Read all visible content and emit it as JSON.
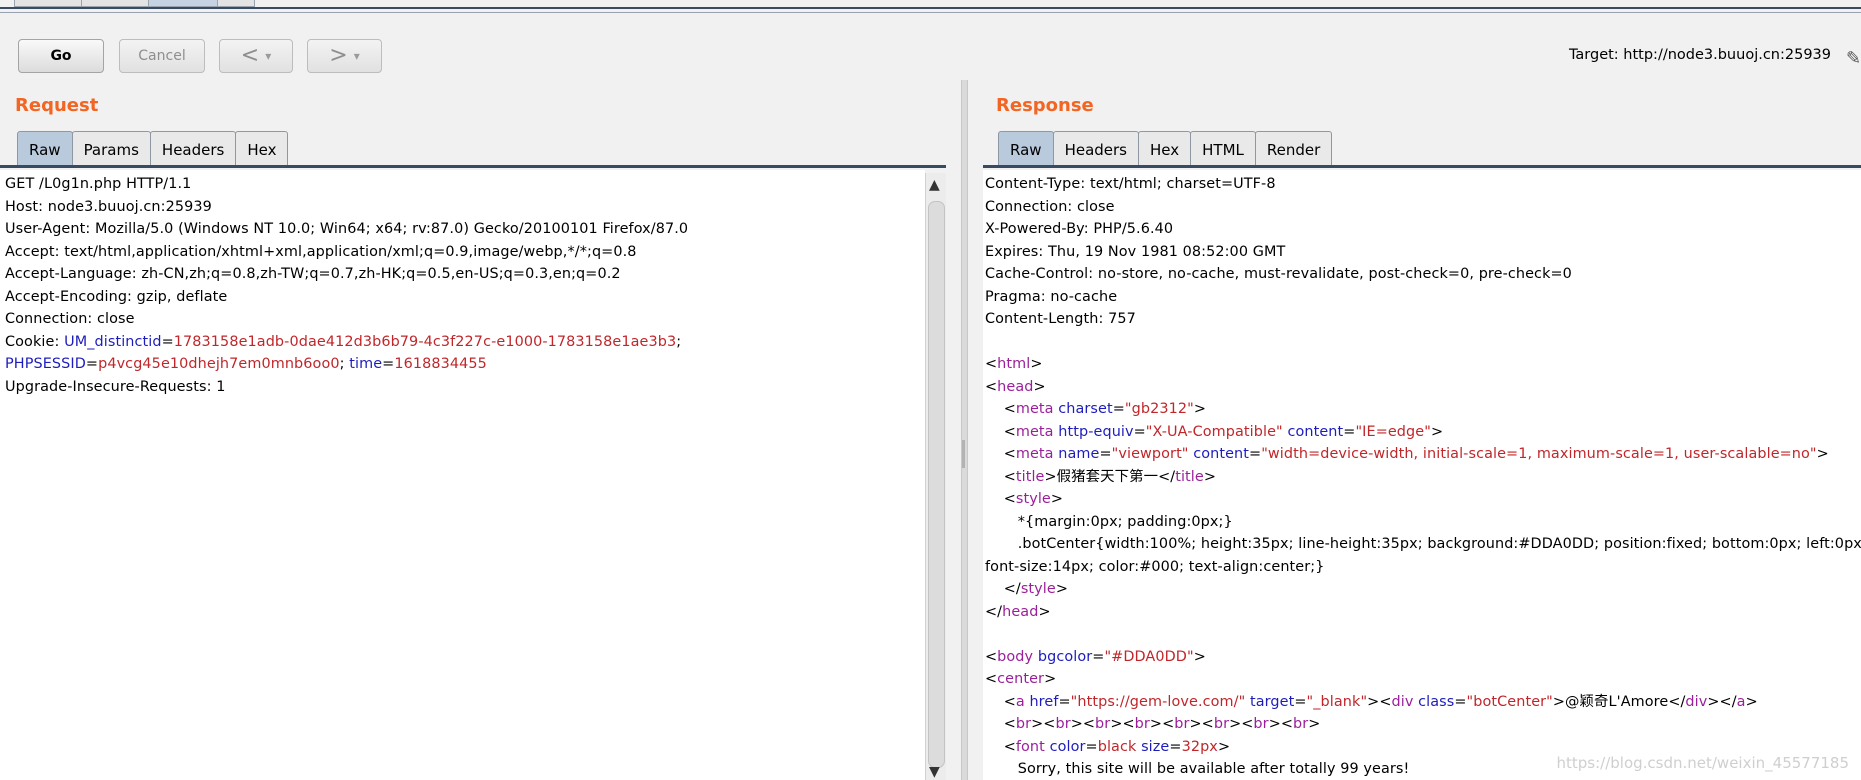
{
  "toolbar": {
    "go_label": "Go",
    "cancel_label": "Cancel",
    "back_glyph": "<",
    "forward_glyph": ">",
    "dropdown_glyph": "▾",
    "target_label": "Target: http://node3.buuoj.cn:25939",
    "edit_icon": "pencil-icon"
  },
  "request": {
    "title": "Request",
    "tabs": [
      "Raw",
      "Params",
      "Headers",
      "Hex"
    ],
    "active_tab": "Raw",
    "lines": [
      [
        {
          "t": "GET /L0g1n.php HTTP/1.1",
          "c": "key"
        }
      ],
      [
        {
          "t": "Host: node3.buuoj.cn:25939",
          "c": "key"
        }
      ],
      [
        {
          "t": "User-Agent: Mozilla/5.0 (Windows NT 10.0; Win64; x64; rv:87.0) Gecko/20100101 Firefox/87.0",
          "c": "key"
        }
      ],
      [
        {
          "t": "Accept: text/html,application/xhtml+xml,application/xml;q=0.9,image/webp,*/*;q=0.8",
          "c": "key"
        }
      ],
      [
        {
          "t": "Accept-Language: zh-CN,zh;q=0.8,zh-TW;q=0.7,zh-HK;q=0.5,en-US;q=0.3,en;q=0.2",
          "c": "key"
        }
      ],
      [
        {
          "t": "Accept-Encoding: gzip, deflate",
          "c": "key"
        }
      ],
      [
        {
          "t": "Connection: close",
          "c": "key"
        }
      ],
      [
        {
          "t": "Cookie: ",
          "c": "key"
        },
        {
          "t": "UM_distinctid",
          "c": "blue"
        },
        {
          "t": "=",
          "c": "key"
        },
        {
          "t": "1783158e1adb-0dae412d3b6b79-4c3f227c-e1000-1783158e1ae3b3",
          "c": "red"
        },
        {
          "t": ";",
          "c": "key"
        }
      ],
      [
        {
          "t": "PHPSESSID",
          "c": "blue"
        },
        {
          "t": "=",
          "c": "key"
        },
        {
          "t": "p4vcg45e10dhejh7em0mnb6oo0",
          "c": "red"
        },
        {
          "t": "; ",
          "c": "key"
        },
        {
          "t": "time",
          "c": "blue"
        },
        {
          "t": "=",
          "c": "key"
        },
        {
          "t": "1618834455",
          "c": "red"
        }
      ],
      [
        {
          "t": "Upgrade-Insecure-Requests: 1",
          "c": "key"
        }
      ]
    ]
  },
  "response": {
    "title": "Response",
    "tabs": [
      "Raw",
      "Headers",
      "Hex",
      "HTML",
      "Render"
    ],
    "active_tab": "Raw",
    "lines": [
      [
        {
          "t": "Content-Type: text/html; charset=UTF-8",
          "c": "key"
        }
      ],
      [
        {
          "t": "Connection: close",
          "c": "key"
        }
      ],
      [
        {
          "t": "X-Powered-By: PHP/5.6.40",
          "c": "key"
        }
      ],
      [
        {
          "t": "Expires: Thu, 19 Nov 1981 08:52:00 GMT",
          "c": "key"
        }
      ],
      [
        {
          "t": "Cache-Control: no-store, no-cache, must-revalidate, post-check=0, pre-check=0",
          "c": "key"
        }
      ],
      [
        {
          "t": "Pragma: no-cache",
          "c": "key"
        }
      ],
      [
        {
          "t": "Content-Length: 757",
          "c": "key"
        }
      ],
      [
        {
          "t": "",
          "c": "key"
        }
      ],
      [
        {
          "t": "<",
          "c": "key"
        },
        {
          "t": "html",
          "c": "purple"
        },
        {
          "t": ">",
          "c": "key"
        }
      ],
      [
        {
          "t": "<",
          "c": "key"
        },
        {
          "t": "head",
          "c": "purple"
        },
        {
          "t": ">",
          "c": "key"
        }
      ],
      [
        {
          "t": "    <",
          "c": "key"
        },
        {
          "t": "meta",
          "c": "purple"
        },
        {
          "t": " charset",
          "c": "blue"
        },
        {
          "t": "=",
          "c": "key"
        },
        {
          "t": "\"gb2312\"",
          "c": "red"
        },
        {
          "t": ">",
          "c": "key"
        }
      ],
      [
        {
          "t": "    <",
          "c": "key"
        },
        {
          "t": "meta",
          "c": "purple"
        },
        {
          "t": " http-equiv",
          "c": "blue"
        },
        {
          "t": "=",
          "c": "key"
        },
        {
          "t": "\"X-UA-Compatible\"",
          "c": "red"
        },
        {
          "t": " content",
          "c": "blue"
        },
        {
          "t": "=",
          "c": "key"
        },
        {
          "t": "\"IE=edge\"",
          "c": "red"
        },
        {
          "t": ">",
          "c": "key"
        }
      ],
      [
        {
          "t": "    <",
          "c": "key"
        },
        {
          "t": "meta",
          "c": "purple"
        },
        {
          "t": " name",
          "c": "blue"
        },
        {
          "t": "=",
          "c": "key"
        },
        {
          "t": "\"viewport\"",
          "c": "red"
        },
        {
          "t": " content",
          "c": "blue"
        },
        {
          "t": "=",
          "c": "key"
        },
        {
          "t": "\"width=device-width, initial-scale=1, maximum-scale=1, user-scalable=no\"",
          "c": "red"
        },
        {
          "t": ">",
          "c": "key"
        }
      ],
      [
        {
          "t": "    <",
          "c": "key"
        },
        {
          "t": "title",
          "c": "purple"
        },
        {
          "t": ">",
          "c": "key"
        },
        {
          "t": "假猪套天下第一",
          "c": "key"
        },
        {
          "t": "</",
          "c": "key"
        },
        {
          "t": "title",
          "c": "purple"
        },
        {
          "t": ">",
          "c": "key"
        }
      ],
      [
        {
          "t": "    <",
          "c": "key"
        },
        {
          "t": "style",
          "c": "purple"
        },
        {
          "t": ">",
          "c": "key"
        }
      ],
      [
        {
          "t": "       *{margin:0px; padding:0px;}",
          "c": "key"
        }
      ],
      [
        {
          "t": "       .botCenter{width:100%; height:35px; line-height:35px; background:#DDA0DD; position:fixed; bottom:0px; left:0px;",
          "c": "key"
        }
      ],
      [
        {
          "t": "font-size:14px; color:#000; text-align:center;}",
          "c": "key"
        }
      ],
      [
        {
          "t": "    </",
          "c": "key"
        },
        {
          "t": "style",
          "c": "purple"
        },
        {
          "t": ">",
          "c": "key"
        }
      ],
      [
        {
          "t": "</",
          "c": "key"
        },
        {
          "t": "head",
          "c": "purple"
        },
        {
          "t": ">",
          "c": "key"
        }
      ],
      [
        {
          "t": "",
          "c": "key"
        }
      ],
      [
        {
          "t": "<",
          "c": "key"
        },
        {
          "t": "body",
          "c": "purple"
        },
        {
          "t": " bgcolor",
          "c": "blue"
        },
        {
          "t": "=",
          "c": "key"
        },
        {
          "t": "\"#DDA0DD\"",
          "c": "red"
        },
        {
          "t": ">",
          "c": "key"
        }
      ],
      [
        {
          "t": "<",
          "c": "key"
        },
        {
          "t": "center",
          "c": "purple"
        },
        {
          "t": ">",
          "c": "key"
        }
      ],
      [
        {
          "t": "    <",
          "c": "key"
        },
        {
          "t": "a",
          "c": "purple"
        },
        {
          "t": " href",
          "c": "blue"
        },
        {
          "t": "=",
          "c": "key"
        },
        {
          "t": "\"https://gem-love.com/\"",
          "c": "red"
        },
        {
          "t": " target",
          "c": "blue"
        },
        {
          "t": "=",
          "c": "key"
        },
        {
          "t": "\"_blank\"",
          "c": "red"
        },
        {
          "t": "><",
          "c": "key"
        },
        {
          "t": "div",
          "c": "purple"
        },
        {
          "t": " class",
          "c": "blue"
        },
        {
          "t": "=",
          "c": "key"
        },
        {
          "t": "\"botCenter\"",
          "c": "red"
        },
        {
          "t": ">@颖奇L'Amore</",
          "c": "key"
        },
        {
          "t": "div",
          "c": "purple"
        },
        {
          "t": "></",
          "c": "key"
        },
        {
          "t": "a",
          "c": "purple"
        },
        {
          "t": ">",
          "c": "key"
        }
      ],
      [
        {
          "t": "    <",
          "c": "key"
        },
        {
          "t": "br",
          "c": "purple"
        },
        {
          "t": "><",
          "c": "key"
        },
        {
          "t": "br",
          "c": "purple"
        },
        {
          "t": "><",
          "c": "key"
        },
        {
          "t": "br",
          "c": "purple"
        },
        {
          "t": "><",
          "c": "key"
        },
        {
          "t": "br",
          "c": "purple"
        },
        {
          "t": "><",
          "c": "key"
        },
        {
          "t": "br",
          "c": "purple"
        },
        {
          "t": "><",
          "c": "key"
        },
        {
          "t": "br",
          "c": "purple"
        },
        {
          "t": "><",
          "c": "key"
        },
        {
          "t": "br",
          "c": "purple"
        },
        {
          "t": "><",
          "c": "key"
        },
        {
          "t": "br",
          "c": "purple"
        },
        {
          "t": ">",
          "c": "key"
        }
      ],
      [
        {
          "t": "    <",
          "c": "key"
        },
        {
          "t": "font",
          "c": "purple"
        },
        {
          "t": " color",
          "c": "blue"
        },
        {
          "t": "=",
          "c": "key"
        },
        {
          "t": "black",
          "c": "red"
        },
        {
          "t": " size",
          "c": "blue"
        },
        {
          "t": "=",
          "c": "key"
        },
        {
          "t": "32px",
          "c": "red"
        },
        {
          "t": ">",
          "c": "key"
        }
      ],
      [
        {
          "t": "       Sorry, this site will be available after totally 99 years!",
          "c": "key"
        }
      ]
    ]
  },
  "watermark": "https://blog.csdn.net/weixin_45577185"
}
